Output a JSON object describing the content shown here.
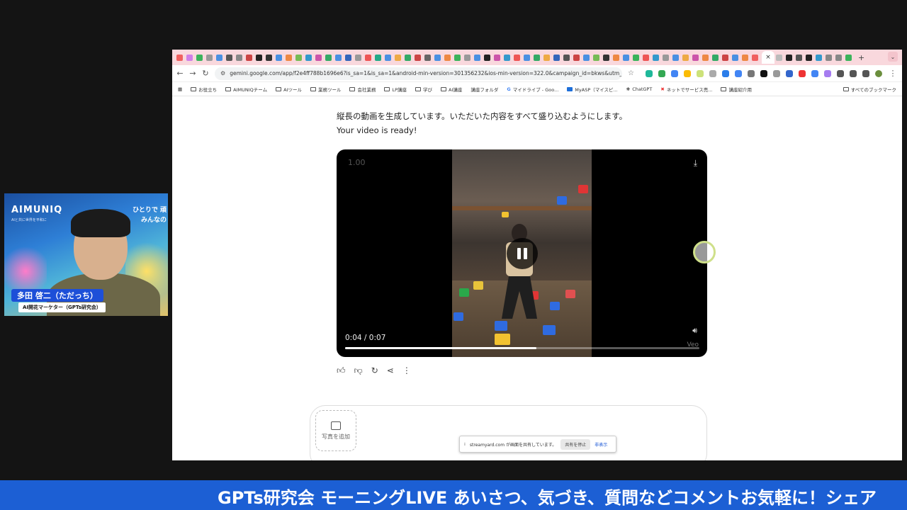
{
  "webcam": {
    "brand": "AIMUNIQ",
    "brand_sub": "AIと共に世界を平和に",
    "tagline_1": "ひとりで 頑",
    "tagline_2": "みんなの",
    "presenter_name": "多田 啓二（ただっち）",
    "presenter_role": "AI開花マーケター（GPTs研究会）"
  },
  "browser": {
    "active_tab_close": "×",
    "new_tab": "+",
    "url": "gemini.google.com/app/f2e4ff788b1696e6?is_sa=1&is_sa=1&android-min-version=301356232&ios-min-version=322.0&campaign_id=bkws&utm_source=...",
    "bookmarks": [
      "お役立ち",
      "AIMUNIQチーム",
      "AIツール",
      "業務ツール",
      "会社業務",
      "LP講座",
      "学び",
      "AI講座",
      "講座フォルダ",
      "マイドライブ - Goo...",
      "MyASP（マイスピ...",
      "ChatGPT",
      "ネットでサービス売...",
      "講座紹介用"
    ],
    "bookmarks_all": "すべてのブックマーク"
  },
  "chat": {
    "message_line_1": "縦長の動画を生成しています。いただいた内容をすべて盛り込むようにします。",
    "message_line_2": "Your video is ready!"
  },
  "video": {
    "speed": "1.00",
    "time": "0:04 / 0:07",
    "progress": 0.54,
    "watermark": "Veo"
  },
  "composer": {
    "add_photo_label": "写真を追加"
  },
  "share_notice": {
    "text": "streamyard.com が画面を共有しています。",
    "stop": "共有を停止",
    "hide": "非表示"
  },
  "ticker": {
    "text": "GPTs研究会 モーニングLIVE あいさつ、気づき、質問などコメントお気軽に！シェア"
  },
  "colors": {
    "ticker_bg": "#1c5fd4",
    "tabstrip_bg": "#f9d8dd",
    "name_badge": "#1d4fd8"
  }
}
